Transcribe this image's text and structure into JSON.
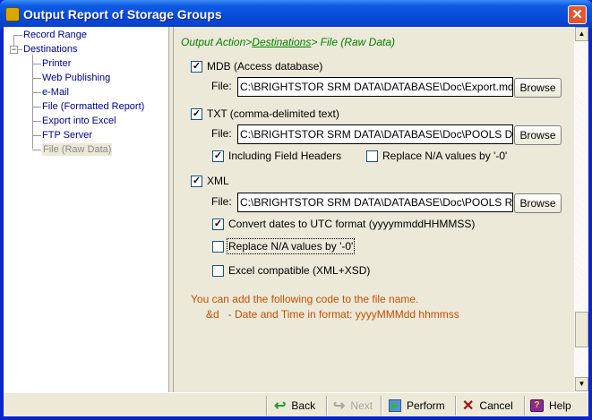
{
  "window": {
    "title": "Output Report of Storage Groups",
    "close": "✕"
  },
  "tree": {
    "items": [
      {
        "label": "Record Range"
      },
      {
        "label": "Destinations"
      },
      {
        "label": "Printer"
      },
      {
        "label": "Web Publishing"
      },
      {
        "label": "e-Mail"
      },
      {
        "label": "File (Formatted Report)"
      },
      {
        "label": "Export into Excel"
      },
      {
        "label": "FTP Server"
      },
      {
        "label": "File (Raw Data)",
        "selected": true
      }
    ]
  },
  "breadcrumb": {
    "part1": "Output Action>",
    "link": "Destinations",
    "part3": "> File (Raw Data)"
  },
  "mdb": {
    "label": "MDB (Access database)",
    "checked": true,
    "file_label": "File:",
    "file": "C:\\BRIGHTSTOR SRM DATA\\DATABASE\\Doc\\Export.mdb",
    "browse": "Browse"
  },
  "txt": {
    "label": "TXT (comma-delimited text)",
    "checked": true,
    "file_label": "File:",
    "file": "C:\\BRIGHTSTOR SRM DATA\\DATABASE\\Doc\\POOLS Data.txt",
    "browse": "Browse",
    "headers": {
      "label": "Including Field Headers",
      "checked": true
    },
    "replace": {
      "label": "Replace N/A values by '-0'",
      "checked": false
    }
  },
  "xml": {
    "label": "XML",
    "checked": true,
    "file_label": "File:",
    "file": "C:\\BRIGHTSTOR SRM DATA\\DATABASE\\Doc\\POOLS Raw.xml",
    "browse": "Browse",
    "utc": {
      "label": "Convert dates to UTC format (yyyymmddHHMMSS)",
      "checked": true
    },
    "replace": {
      "label": "Replace N/A values by '-0'",
      "checked": false
    },
    "excel": {
      "label": "Excel compatible (XML+XSD)",
      "checked": false
    }
  },
  "hint": {
    "line1": "You can add the following code to the file name.",
    "line2": "&d   - Date and Time in format: yyyyMMMdd hhmmss"
  },
  "colors": {
    "hint": "#c84d00",
    "breadcrumb": "#008000",
    "tree_text": "#00008b"
  },
  "scroll": {
    "position": 0.9
  },
  "buttons": {
    "back": "Back",
    "next": "Next",
    "perform": "Perform",
    "cancel": "Cancel",
    "help": "Help"
  }
}
